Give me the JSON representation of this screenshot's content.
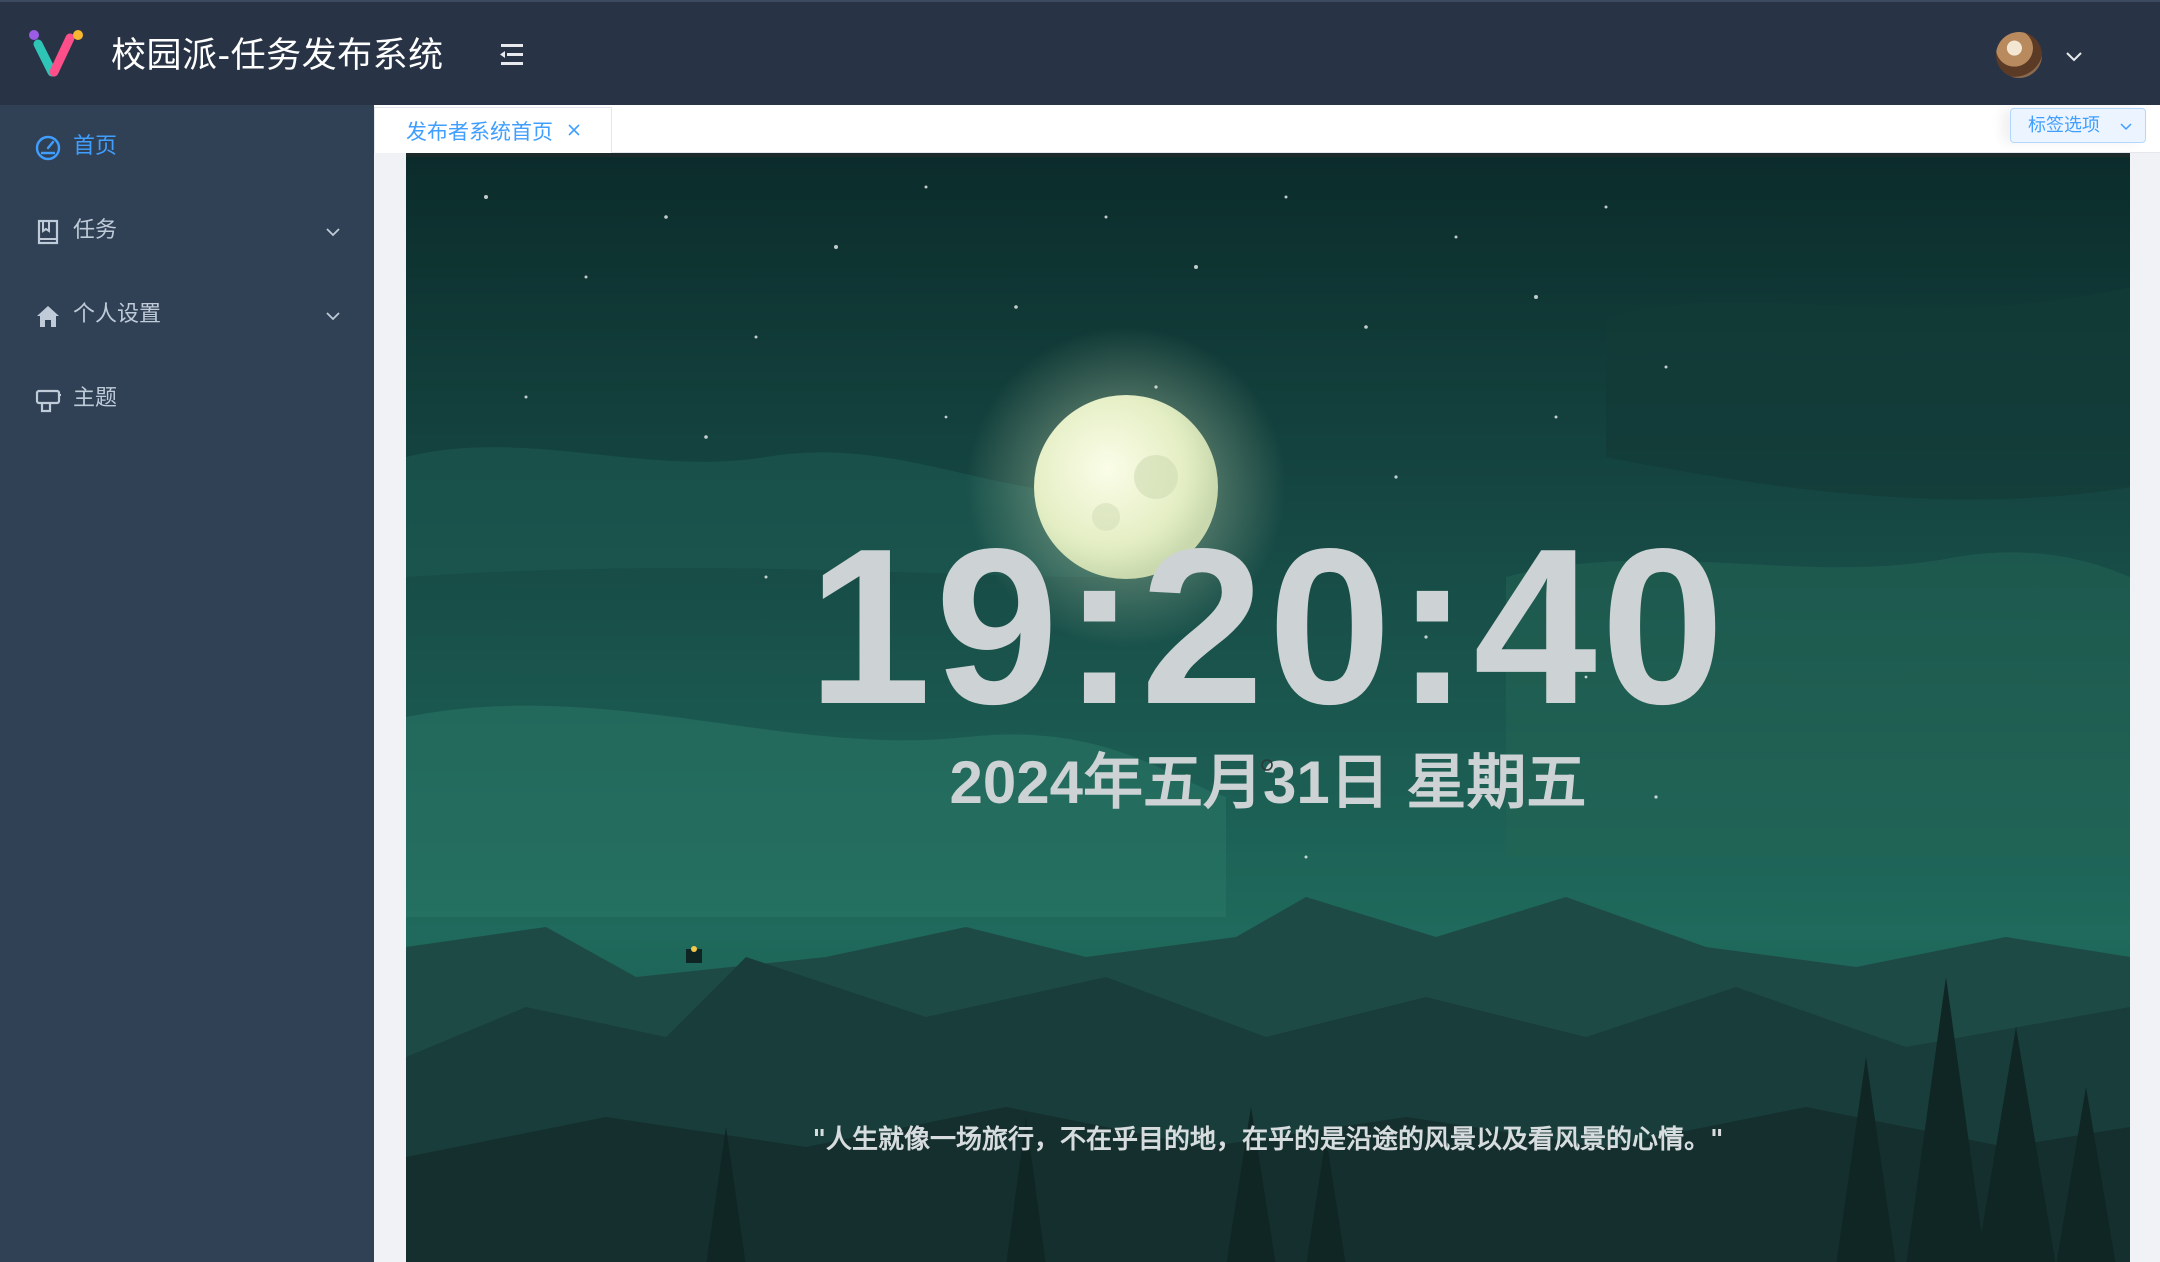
{
  "header": {
    "app_title": "校园派-任务发布系统",
    "menu_toggle_icon": "menu-fold-icon",
    "avatar_caret_icon": "chevron-down-icon"
  },
  "sidebar": {
    "items": [
      {
        "label": "首页",
        "icon": "dashboard-icon",
        "active": true
      },
      {
        "label": "任务",
        "icon": "book-icon",
        "expandable": true
      },
      {
        "label": "个人设置",
        "icon": "home-icon",
        "expandable": true
      },
      {
        "label": "主题",
        "icon": "theme-icon"
      }
    ]
  },
  "tabs": {
    "items": [
      {
        "label": "发布者系统首页",
        "active": true
      }
    ],
    "options_label": "标签选项"
  },
  "main": {
    "time": "19:20:40",
    "date": "2024年五月31日 星期五",
    "quote": "\"人生就像一场旅行，不在乎目的地，在乎的是沿途的风景以及看风景的心情。\""
  },
  "colors": {
    "header_bg": "#283445",
    "sidebar_bg": "#304156",
    "accent": "#409eff",
    "sidebar_text": "#bfcbd9"
  }
}
